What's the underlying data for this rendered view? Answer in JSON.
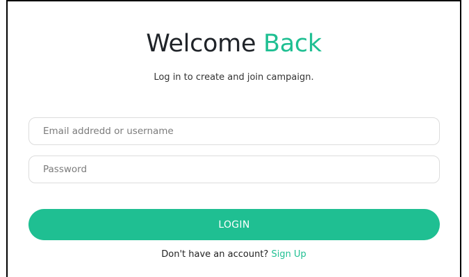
{
  "header": {
    "title_main": "Welcome",
    "title_accent": "Back",
    "subtitle": "Log in to create and join campaign."
  },
  "form": {
    "email": {
      "value": "",
      "placeholder": "Email addredd or username"
    },
    "password": {
      "value": "",
      "placeholder": "Password"
    },
    "login_label": "LOGIN"
  },
  "footer": {
    "prompt": "Don't have an account?",
    "signup_label": "Sign Up"
  },
  "colors": {
    "accent": "#1fbf92",
    "text": "#1f2328",
    "border": "#dcdcdc"
  }
}
